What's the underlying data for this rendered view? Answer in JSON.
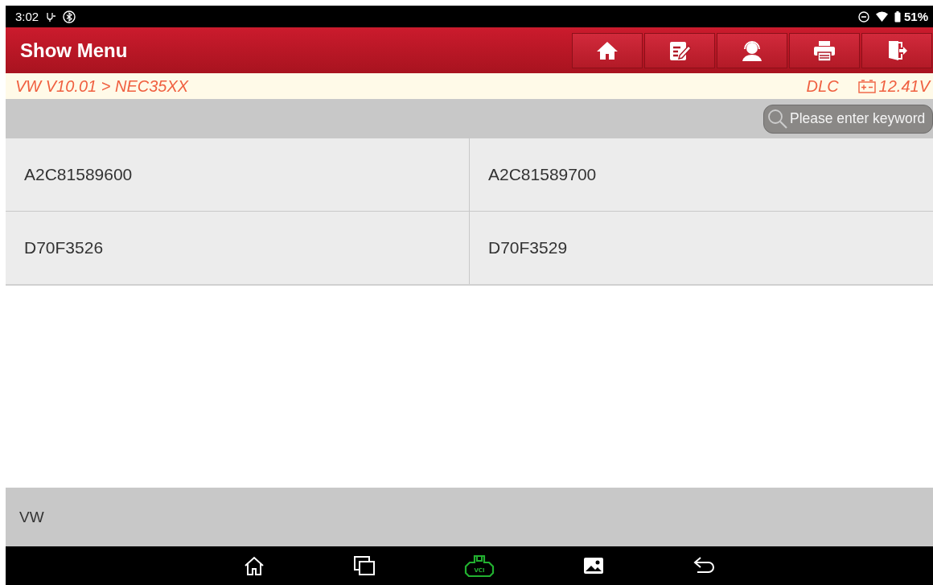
{
  "status_bar": {
    "time": "3:02",
    "battery": "51%"
  },
  "header": {
    "title": "Show Menu"
  },
  "breadcrumb": {
    "path": "VW V10.01 > NEC35XX",
    "connection": "DLC",
    "voltage": "12.41V"
  },
  "search": {
    "placeholder": "Please enter keyword"
  },
  "items": [
    {
      "label": "A2C81589600"
    },
    {
      "label": "A2C81589700"
    },
    {
      "label": "D70F3526"
    },
    {
      "label": "D70F3529"
    }
  ],
  "footer": {
    "text": "VW"
  },
  "nav_bar": {
    "vci_label": "VCI"
  }
}
